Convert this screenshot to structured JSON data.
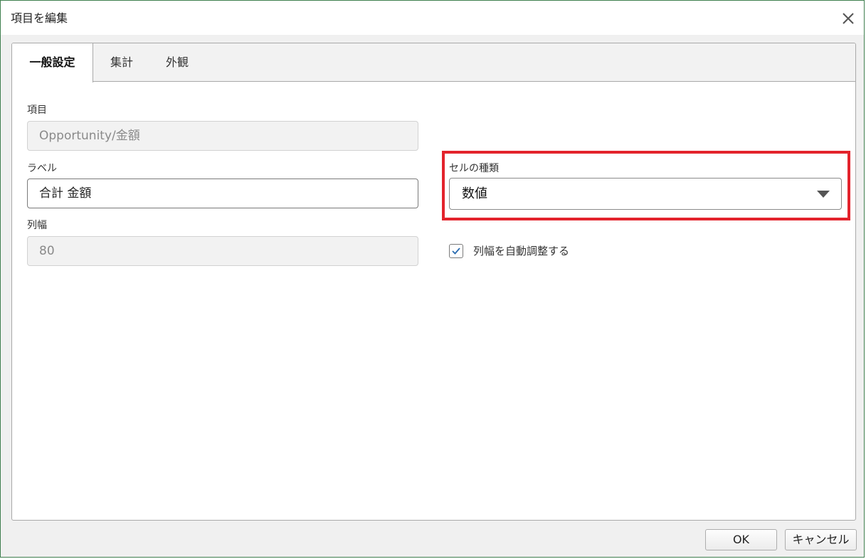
{
  "dialog": {
    "title": "項目を編集",
    "close_icon": "close-icon"
  },
  "tabs": [
    {
      "label": "一般設定",
      "active": true
    },
    {
      "label": "集計",
      "active": false
    },
    {
      "label": "外観",
      "active": false
    }
  ],
  "form": {
    "field": {
      "label": "項目",
      "value": "Opportunity/金額",
      "disabled": true
    },
    "label": {
      "label": "ラベル",
      "value": "合計 金額",
      "disabled": false
    },
    "column_width": {
      "label": "列幅",
      "value": "80",
      "disabled": true
    },
    "cell_type": {
      "label": "セルの種類",
      "selected": "数値"
    },
    "auto_width": {
      "label": "列幅を自動調整する",
      "checked": true
    }
  },
  "buttons": {
    "ok": "OK",
    "cancel": "キャンセル"
  },
  "colors": {
    "highlight": "#e3232c",
    "dialog_border": "#3f7f4f",
    "check": "#2b6cb0"
  }
}
